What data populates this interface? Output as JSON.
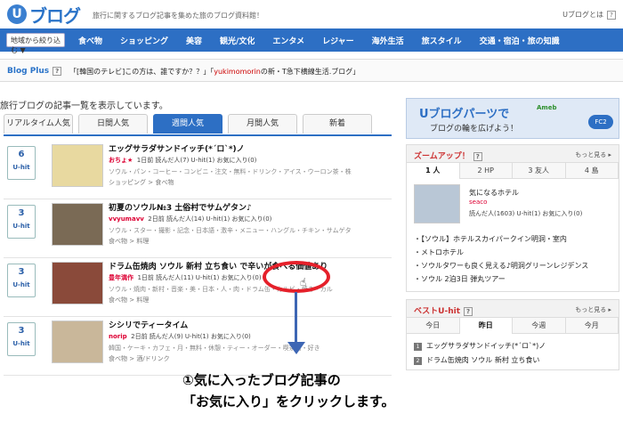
{
  "header": {
    "logo_mark": "U",
    "logo_text": "ブログ",
    "tagline": "旅行に関するブログ記事を集めた旅のブログ資料館！",
    "whatis": "Uブログとは",
    "whatis_q": "?"
  },
  "nav": {
    "region": "地域から絞り込む ▼",
    "items": [
      "食べ物",
      "ショッピング",
      "美容",
      "観光/文化",
      "エンタメ",
      "レジャー",
      "海外生活",
      "旅スタイル",
      "交通・宿泊・旅の知識"
    ]
  },
  "plus": {
    "label": "Blog Plus",
    "q": "?",
    "text": "「[韓国のテレビ]この方は、誰ですか？？」「",
    "link": "yukimomorin",
    "text2": "の新・T急下横線生活.ブログ」"
  },
  "list": {
    "heading": "旅行ブログの記事一覧を表示しています。",
    "tabs": [
      "リアルタイム人気",
      "日間人気",
      "週間人気",
      "月間人気",
      "新着"
    ],
    "active_tab": 2,
    "rows": [
      {
        "rank": "6",
        "rank_label": "U-hit",
        "title": "エッグサラダサンドイッチ(*´ロ`*)ノ",
        "author": "おちょ★",
        "meta": "1日前  読んだ人(7)  U-hit(1)  お気に入り(0)",
        "tags": "ソウル・パン・コーヒー・コンビニ・注文・無料・ドリンク・アイス・ウーロン茶・株",
        "cat": "ショッピング > 食べ物"
      },
      {
        "rank": "3",
        "rank_label": "U-hit",
        "title": "初夏のソウル№3 土俗村でサムゲタン♪",
        "author": "vvyumavv",
        "meta": "2日前  読んだ人(14)  U-hit(1)  お気に入り(0)",
        "tags": "ソウル・スター・撮影・記念・日本語・激辛・メニュー・ハングル・チキン・サムゲタ",
        "cat": "食べ物 > 料理"
      },
      {
        "rank": "3",
        "rank_label": "U-hit",
        "title": "ドラム缶焼肉 ソウル 新村 立ち食い で辛いが食べる価値あり",
        "author": "豊年満作",
        "meta": "1日前  読んだ人(11)  U-hit(1)  お気に入り(0)",
        "tags": "ソウル・焼肉・新村・音楽・美・日本・人・肉・ドラム缶・カルビ・焼き・カル",
        "cat": "食べ物 > 料理"
      },
      {
        "rank": "3",
        "rank_label": "U-hit",
        "title": "シシリでティータイム",
        "author": "norip",
        "meta": "2日前  読んだ人(9)  U-hit(1)  お気に入り(0)",
        "tags": "韓国・ケーキ・カフェ・月・無料・休憩・ティー・オーダー・喫茶店・好き",
        "cat": "食べ物 > 酒/ドリンク"
      }
    ]
  },
  "annotation": {
    "line1": "①気に入ったブログ記事の",
    "line2": "「お気に入り」をクリックします。"
  },
  "banner": {
    "title": "Uブログパーツで",
    "sub": "ブログの輪を広げよう！",
    "ameba": "Ameb",
    "fc2": "FC2"
  },
  "zoom": {
    "title": "ズームアップ！",
    "q": "?",
    "more": "もっと見る ▸",
    "tabs": [
      "1 人",
      "2 HP",
      "3 友人",
      "4 島"
    ],
    "active": 0,
    "item_title": "気になるホテル",
    "item_author": "seaco",
    "item_meta": "読んだ人(1603)  U-hit(1)  お気に入り(0)",
    "list": [
      "・【ソウル】ホテルスカイパークイン明洞・室内",
      "・メトロホテル",
      "・ソウルタワーも良く見える♪明洞グリーンレジデンス",
      "・ソウル 2泊3日 弾丸ツアー"
    ]
  },
  "best": {
    "title": "ベストU-hit",
    "q": "?",
    "more": "もっと見る ▸",
    "tabs": [
      "今日",
      "昨日",
      "今週",
      "今月"
    ],
    "active": 1,
    "list": [
      "エッグサラダサンドイッチ(*´ロ`*)ノ",
      "ドラム缶焼肉 ソウル 新村 立ち食い"
    ]
  },
  "colors": {
    "nav": "#2d6fc4",
    "accent": "#e5202a",
    "arrow": "#3d66b4"
  }
}
